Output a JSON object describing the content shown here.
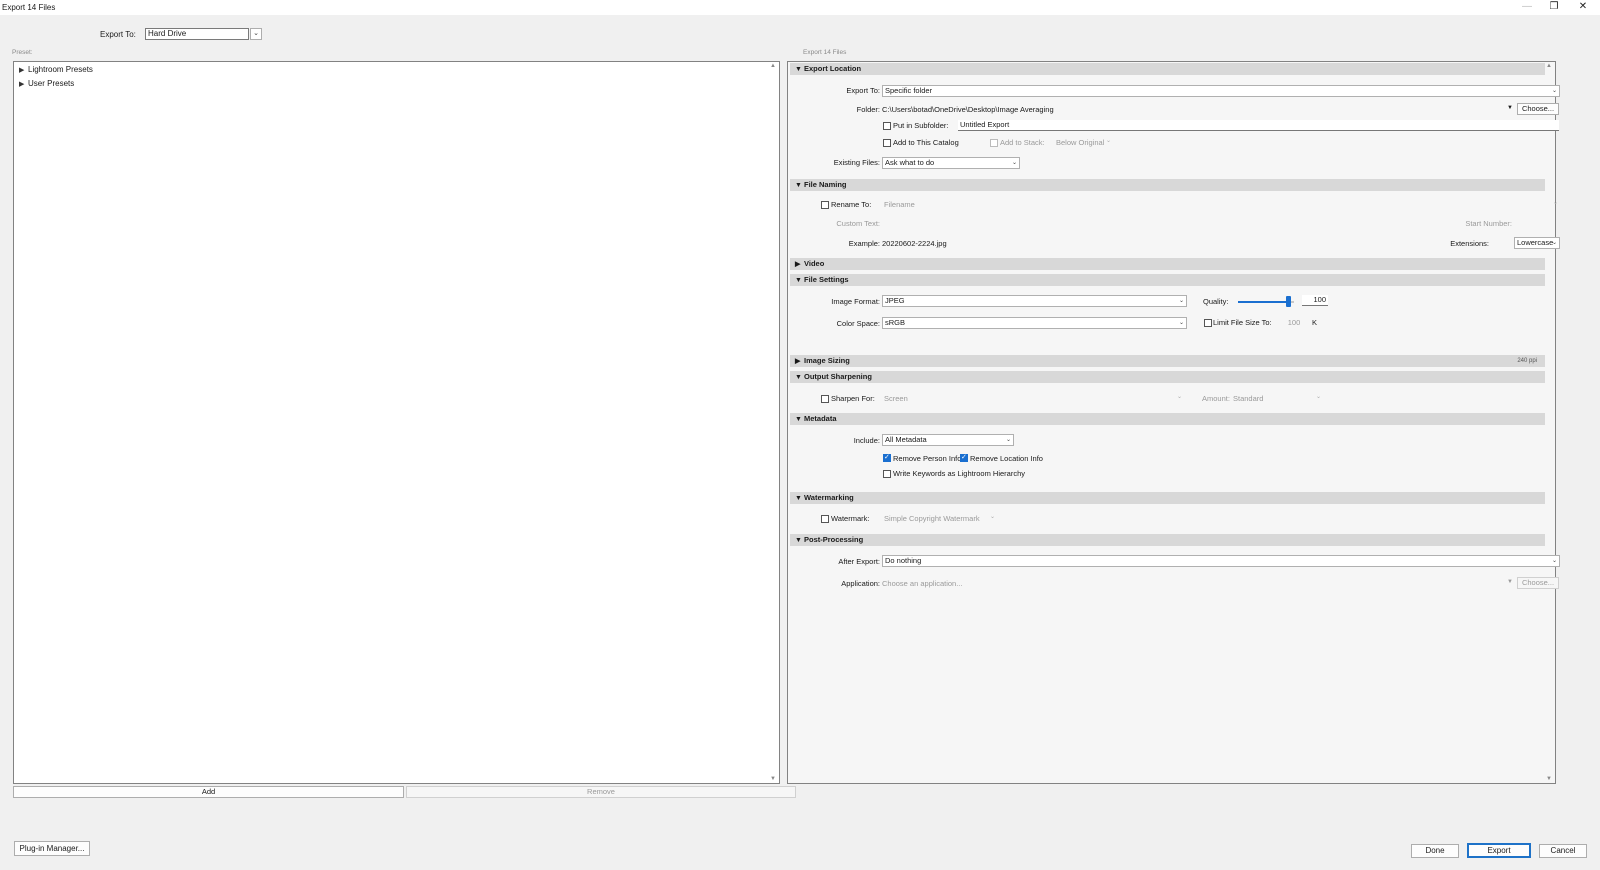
{
  "window": {
    "title": "Export 14 Files",
    "minimize_icon": "minimize-icon",
    "restore_icon": "restore-icon",
    "close_icon": "close-icon"
  },
  "top": {
    "export_to_label": "Export To:",
    "export_to_value": "Hard Drive"
  },
  "preset_panel": {
    "label": "Preset:",
    "items": [
      {
        "label": "Lightroom Presets"
      },
      {
        "label": "User Presets"
      }
    ],
    "add_label": "Add",
    "remove_label": "Remove"
  },
  "settings_panel": {
    "label": "Export 14 Files",
    "export_location": {
      "title": "Export Location",
      "export_to_label": "Export To:",
      "export_to_value": "Specific folder",
      "folder_label": "Folder:",
      "folder_value": "C:\\Users\\botad\\OneDrive\\Desktop\\Image Averaging",
      "choose_label": "Choose...",
      "subfolder_label": "Put in Subfolder:",
      "subfolder_value": "Untitled Export",
      "add_catalog_label": "Add to This Catalog",
      "add_stack_label": "Add to Stack:",
      "stack_value": "Below Original",
      "existing_files_label": "Existing Files:",
      "existing_files_value": "Ask what to do"
    },
    "file_naming": {
      "title": "File Naming",
      "rename_label": "Rename To:",
      "rename_value": "Filename",
      "custom_text_label": "Custom Text:",
      "start_number_label": "Start Number:",
      "example_label": "Example:",
      "example_value": "20220602-2224.jpg",
      "extensions_label": "Extensions:",
      "extensions_value": "Lowercase"
    },
    "video": {
      "title": "Video"
    },
    "file_settings": {
      "title": "File Settings",
      "image_format_label": "Image Format:",
      "image_format_value": "JPEG",
      "quality_label": "Quality:",
      "quality_value": "100",
      "quality_fraction": 0.9,
      "color_space_label": "Color Space:",
      "color_space_value": "sRGB",
      "limit_label": "Limit File Size To:",
      "limit_value": "100",
      "limit_unit": "K"
    },
    "image_sizing": {
      "title": "Image Sizing",
      "summary": "240 ppi"
    },
    "output_sharpening": {
      "title": "Output Sharpening",
      "sharpen_label": "Sharpen For:",
      "sharpen_value": "Screen",
      "amount_label": "Amount:",
      "amount_value": "Standard"
    },
    "metadata": {
      "title": "Metadata",
      "include_label": "Include:",
      "include_value": "All Metadata",
      "remove_person_label": "Remove Person Info",
      "remove_location_label": "Remove Location Info",
      "keywords_label": "Write Keywords as Lightroom Hierarchy"
    },
    "watermarking": {
      "title": "Watermarking",
      "watermark_label": "Watermark:",
      "watermark_value": "Simple Copyright Watermark"
    },
    "post_processing": {
      "title": "Post-Processing",
      "after_export_label": "After Export:",
      "after_export_value": "Do nothing",
      "application_label": "Application:",
      "application_placeholder": "Choose an application...",
      "choose_label": "Choose..."
    }
  },
  "footer": {
    "plugin_manager_label": "Plug-in Manager...",
    "done_label": "Done",
    "export_label": "Export",
    "cancel_label": "Cancel"
  },
  "colors": {
    "accent": "#1a6fd0",
    "section_header": "#d8d8d8",
    "background": "#f0f0f0"
  }
}
